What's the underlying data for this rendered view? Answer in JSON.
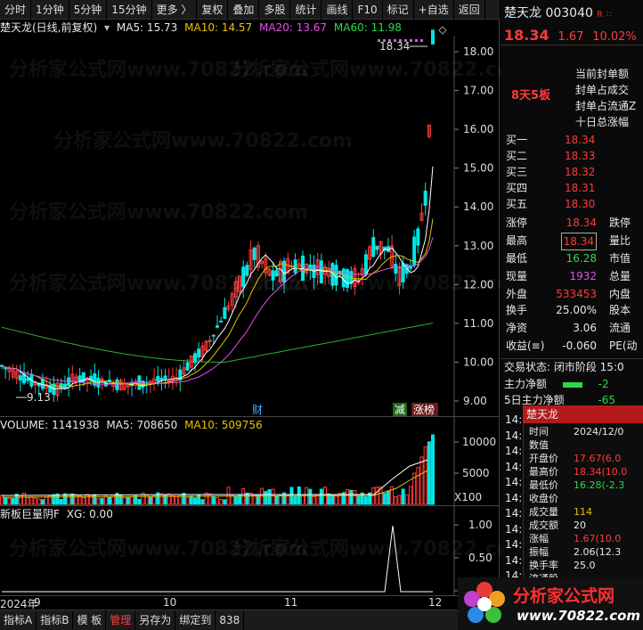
{
  "toolbar": {
    "items": [
      "分时",
      "1分钟",
      "5分钟",
      "15分钟",
      "更多 〉",
      "复权",
      "叠加",
      "多股",
      "统计",
      "画线",
      "F10",
      "标记",
      "+自选",
      "返回"
    ]
  },
  "kline": {
    "title": "楚天龙(日线,前复权)",
    "ma5": "MA5: 15.73",
    "ma10": "MA10: 14.57",
    "ma20": "MA20: 13.67",
    "ma60": "MA60: 11.98",
    "high_label": "18.34",
    "low_label": "9.13",
    "price_ticks": [
      "18.00",
      "17.00",
      "16.00",
      "15.00",
      "14.00",
      "13.00",
      "12.00",
      "11.00",
      "10.00",
      "9.00"
    ],
    "markers": {
      "cai": "财",
      "jian": "减",
      "zhangbang": "涨榜"
    },
    "colors": {
      "ma5": "#ffffff",
      "ma10": "#e6c200",
      "ma20": "#e052e0",
      "ma60": "#2bb32b",
      "up": "#ff3b3b",
      "down": "#00e5e5"
    }
  },
  "volume": {
    "label": "VOLUME: 1141938",
    "ma5": "MA5: 708650",
    "ma10": "MA10: 509756",
    "ticks": [
      "10000",
      "5000",
      "X100"
    ]
  },
  "indicator": {
    "name": "新板巨量阴F",
    "xg": "XG: 0.00",
    "ticks": [
      "1.00",
      "0.50",
      "0.00"
    ]
  },
  "dates": [
    "2024年",
    "9",
    "10",
    "11",
    "12"
  ],
  "bottom_tabs": [
    "指标A",
    "指标B",
    "模 板",
    "管理",
    "另存为",
    "绑定到",
    "838"
  ],
  "right": {
    "name": "楚天龙",
    "code": "003040",
    "r_badge": "R",
    "price": "18.34",
    "change": "1.67",
    "pct": "10.02%",
    "streak": "8天5板",
    "limit_info": [
      "当前封单额",
      "封单占成交",
      "封单占流通Z",
      "十日总涨幅"
    ],
    "sell_labels": [
      "买一",
      "买二",
      "买三",
      "买四",
      "买五"
    ],
    "sell_values": [
      "18.34",
      "18.33",
      "18.32",
      "18.31",
      "18.30"
    ],
    "stats": [
      {
        "l": "涨停",
        "v": "18.34",
        "l2": "跌停"
      },
      {
        "l": "最高",
        "v": "18.34",
        "l2": "量比"
      },
      {
        "l": "最低",
        "v": "16.28",
        "l2": "市值"
      },
      {
        "l": "现量",
        "v": "1932",
        "l2": "总量"
      },
      {
        "l": "外盘",
        "v": "533453",
        "l2": "内盘"
      }
    ],
    "stats2": [
      {
        "l": "换手",
        "v": "25.00%",
        "l2": "股本"
      },
      {
        "l": "净资",
        "v": "3.06",
        "l2": "流通"
      },
      {
        "l": "收益(≡)",
        "v": "-0.060",
        "l2": "PE(动"
      }
    ],
    "trade_status": "交易状态: 闭市阶段 15:0",
    "main_flow": "主力净额",
    "main_flow_val": "-2",
    "main_flow5": "5日主力净额",
    "main_flow5_val": "-65",
    "popup_title": "楚天龙",
    "popup_rows": [
      {
        "l": "时间",
        "v": "2024/12/0"
      },
      {
        "l": "数值",
        "v": ""
      },
      {
        "l": "开盘价",
        "v": "17.67(6.0"
      },
      {
        "l": "最高价",
        "v": "18.34(10.0"
      },
      {
        "l": "最低价",
        "v": "16.28(-2.3"
      },
      {
        "l": "收盘价",
        "v": ""
      },
      {
        "l": "成交量",
        "v": "114"
      },
      {
        "l": "成交额",
        "v": "20"
      },
      {
        "l": "涨幅",
        "v": "1.67(10.0"
      },
      {
        "l": "振幅",
        "v": "2.06(12.3"
      },
      {
        "l": "换手率",
        "v": "25.0"
      },
      {
        "l": "流通股",
        "v": ""
      }
    ],
    "time_labels": [
      "14:",
      "14:",
      "14:",
      "14:",
      "14:",
      "14:",
      "14:",
      "14:",
      "14:",
      "14:",
      "14:",
      "14:",
      "14:"
    ]
  },
  "logo": {
    "main": "分析家公式网",
    "url": "www.70822.com"
  },
  "watermark": "分析家公式网www.70822.com"
}
